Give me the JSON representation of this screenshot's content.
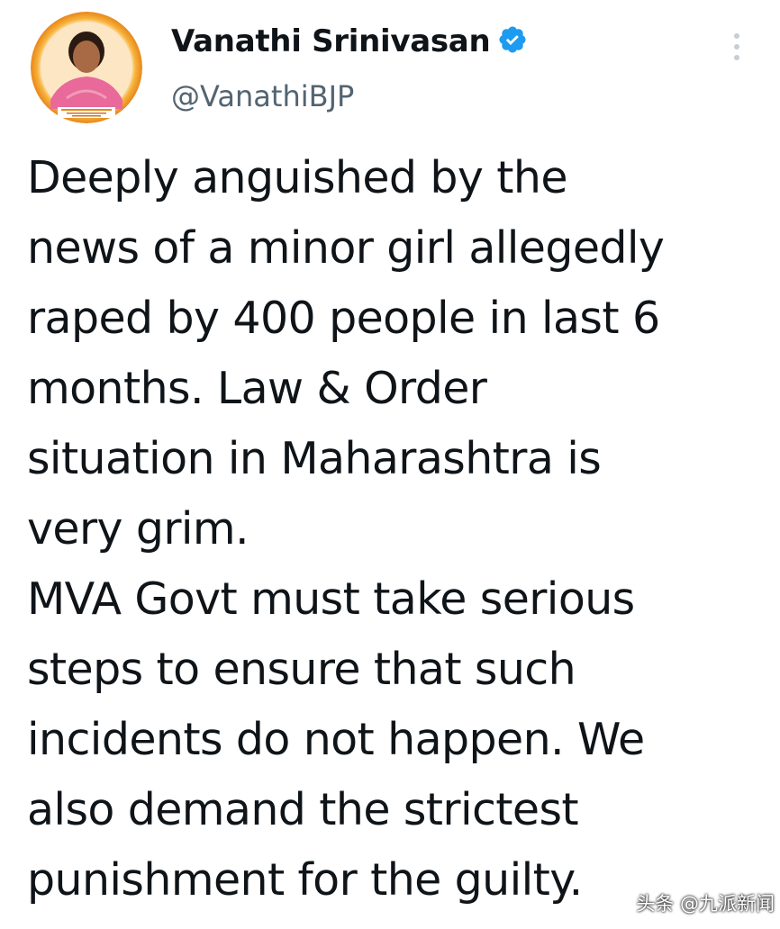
{
  "tweet": {
    "author": {
      "display_name": "Vanathi Srinivasan",
      "handle": "@VanathiBJP",
      "verified": true,
      "avatar_icon": "profile-photo"
    },
    "text": "Deeply anguished by the\nnews of a minor girl allegedly\nraped by 400 people in last 6\nmonths. Law & Order\nsituation in Maharashtra is\nvery grim.\nMVA Govt must take serious\nsteps to ensure that such\nincidents do not happen. We\nalso demand the strictest\npunishment for the guilty.",
    "more_icon": "vertical-ellipsis-icon"
  },
  "watermark": {
    "text": "头条 @九派新闻"
  },
  "colors": {
    "verified_blue": "#1d9bf0",
    "handle_gray": "#536471",
    "text": "#0f1419",
    "avatar_ring": "#f5a623"
  }
}
